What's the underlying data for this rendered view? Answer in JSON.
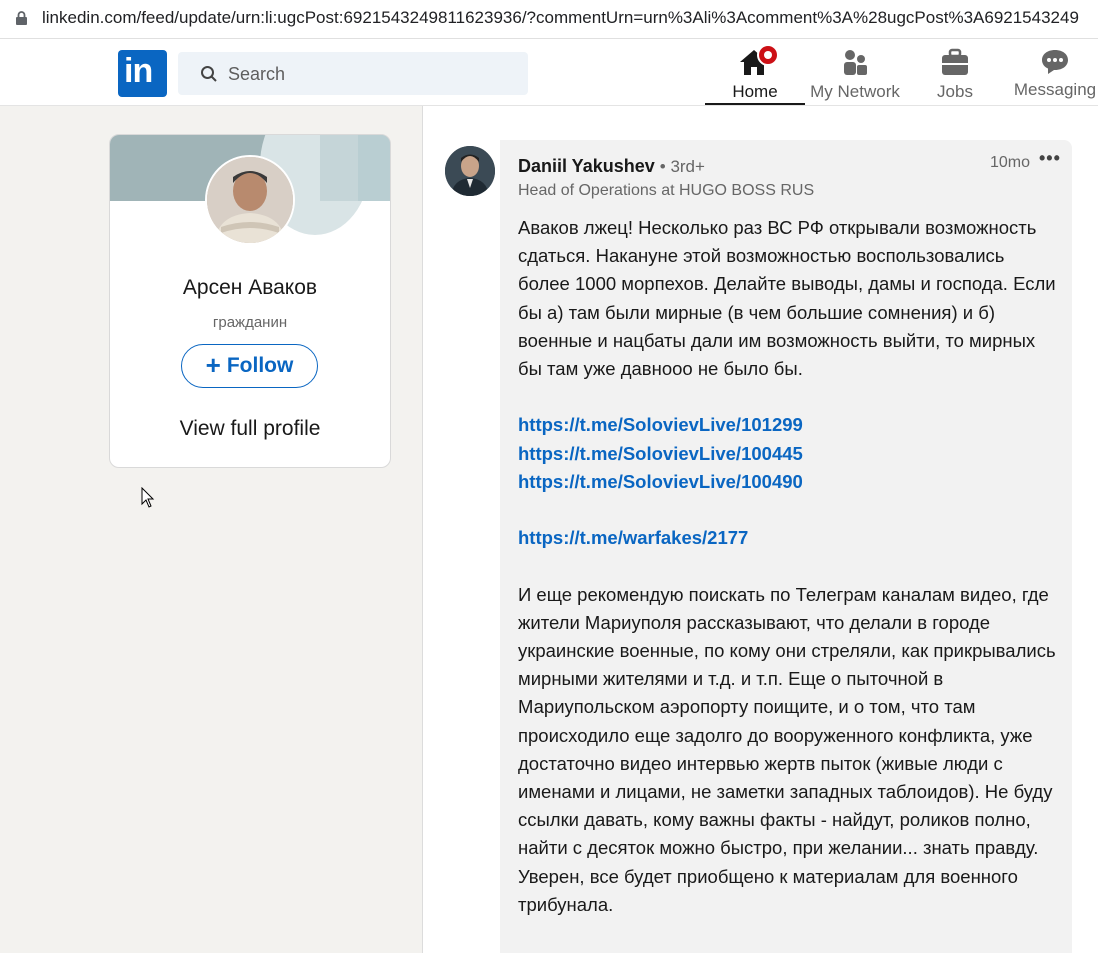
{
  "browser": {
    "url": "linkedin.com/feed/update/urn:li:ugcPost:6921543249811623936/?commentUrn=urn%3Ali%3Acomment%3A%28ugcPost%3A6921543249"
  },
  "nav": {
    "logo_text": "in",
    "search_placeholder": "Search",
    "items": [
      {
        "label": "Home",
        "icon": "home-icon",
        "active": true
      },
      {
        "label": "My Network",
        "icon": "people-icon"
      },
      {
        "label": "Jobs",
        "icon": "briefcase-icon"
      },
      {
        "label": "Messaging",
        "icon": "chat-icon"
      }
    ],
    "accent_color": "#0a66c2",
    "notification_color": "#cc1016"
  },
  "profile_card": {
    "name": "Арсен Аваков",
    "title": "гражданин",
    "follow_label": "Follow",
    "view_profile_label": "View full profile"
  },
  "comment": {
    "author": "Daniil Yakushev",
    "degree": "• 3rd+",
    "headline": "Head of Operations at HUGO BOSS RUS",
    "time": "10mo",
    "more": "•••",
    "paragraph1": "Аваков лжец! Несколько раз ВС РФ открывали возможность сдаться. Накануне этой возможностью воспользовались более 1000 морпехов. Делайте выводы, дамы и господа. Если бы а) там были мирные (в чем большие сомнения) и б) военные и нацбаты дали им возможность выйти, то мирных бы там уже давнооо не было бы.",
    "links": [
      "https://t.me/SolovievLive/101299",
      "https://t.me/SolovievLive/100445",
      "https://t.me/SolovievLive/100490"
    ],
    "link4": "https://t.me/warfakes/2177",
    "paragraph2": "И еще рекомендую поискать по Телеграм каналам видео, где жители Мариуполя рассказывают, что делали в городе украинские военные, по кому они стреляли, как прикрывались мирными жителями и т.д. и т.п. Еще о пыточной в Мариупольском аэропорту поищите, и о том, что там происходило еще задолго до вооруженного конфликта, уже достаточно видео интервью жертв пыток (живые люди с именами и лицами, не заметки западных таблоидов). Не буду ссылки давать, кому важны факты - найдут, роликов полно, найти с десяток можно быстро, при желании... знать правду. Уверен, все будет приобщено к материалам для военного трибунала."
  }
}
